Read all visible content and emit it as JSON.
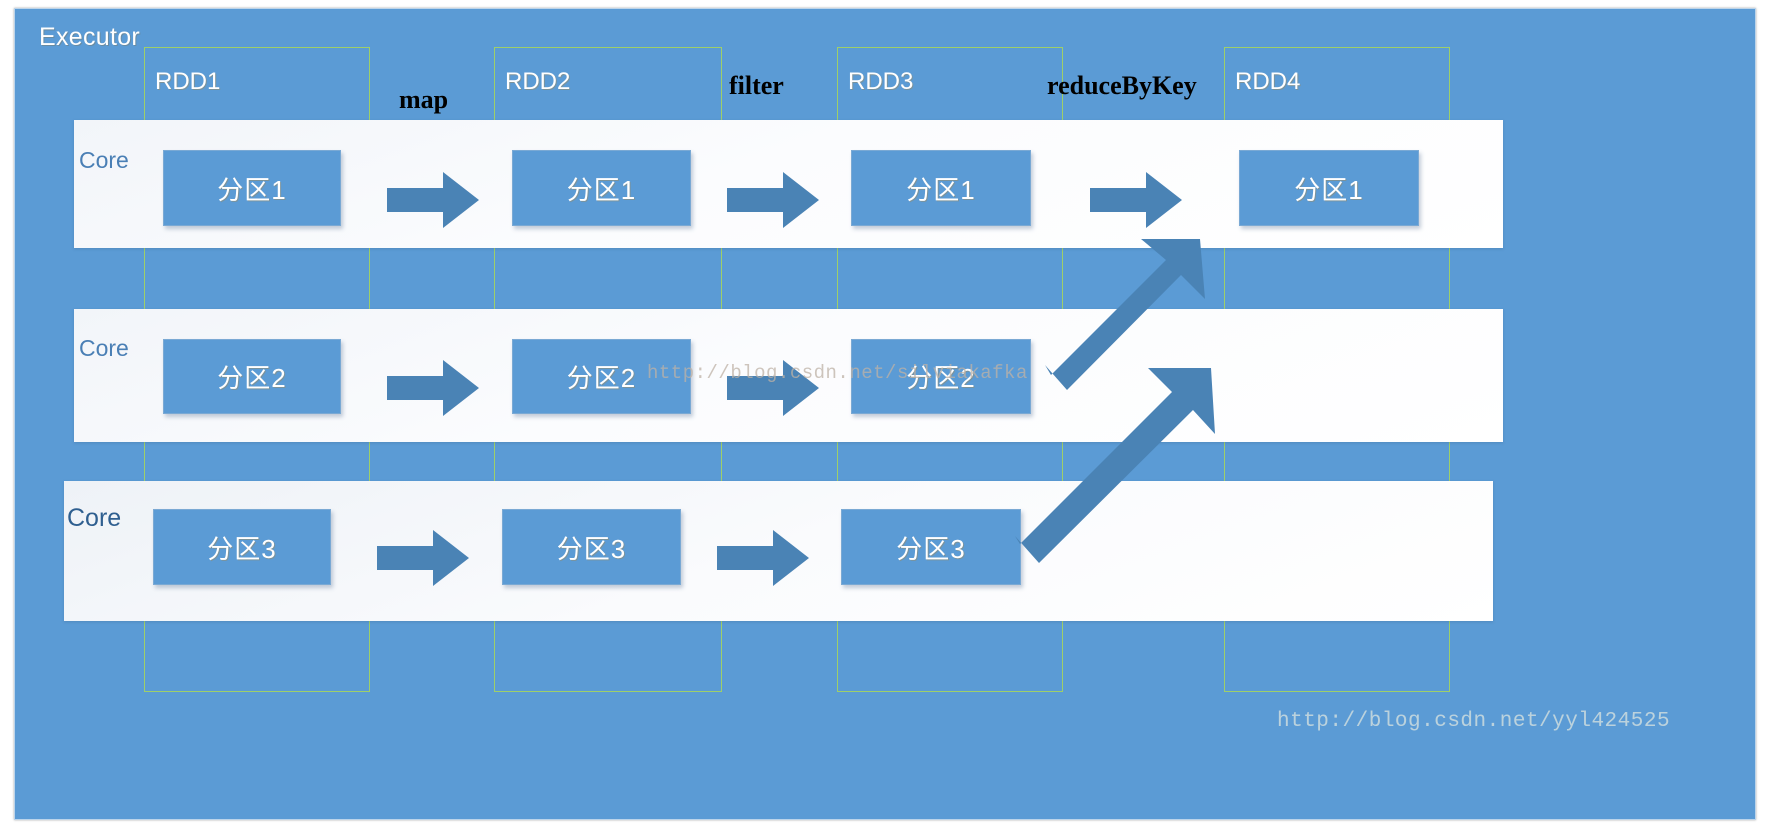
{
  "executor": {
    "title": "Executor",
    "panel_color": "#5b9bd5",
    "frame_color": "#9ecf6a"
  },
  "rdd_columns": [
    {
      "label": "RDD1"
    },
    {
      "label": "RDD2"
    },
    {
      "label": "RDD3"
    },
    {
      "label": "RDD4"
    }
  ],
  "operations": [
    {
      "label": "map"
    },
    {
      "label": "filter"
    },
    {
      "label": "reduceByKey"
    }
  ],
  "cores": [
    {
      "label": "Core"
    },
    {
      "label": "Core"
    },
    {
      "label": "Core"
    }
  ],
  "partitions": {
    "rdd1": [
      "分区1",
      "分区2",
      "分区3"
    ],
    "rdd2": [
      "分区1",
      "分区2",
      "分区3"
    ],
    "rdd3": [
      "分区1",
      "分区2",
      "分区3"
    ],
    "rdd4": [
      "分区1"
    ]
  },
  "watermarks": {
    "middle": "http://blog.csdn.net/silviakafka",
    "corner": "http://blog.csdn.net/yyl424525"
  },
  "colors": {
    "partition_fill": "#5b9bd5",
    "arrow_fill": "#4a83b5",
    "band_white": "#f5f7fa",
    "core_text": "#4a7fb5",
    "rdd_outline": "#9ecf6a"
  }
}
